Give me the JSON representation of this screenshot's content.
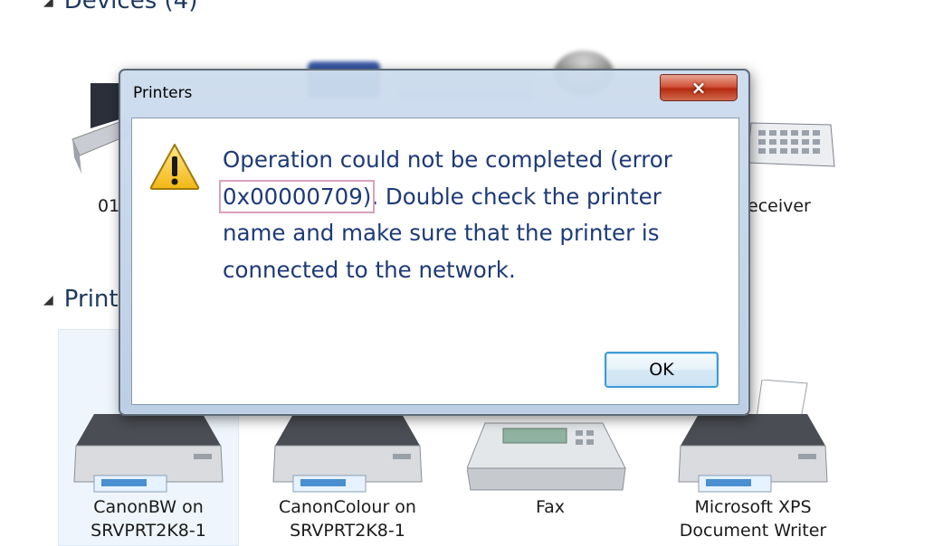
{
  "background": {
    "devices_header": "Devices (4)",
    "printers_header": "Print",
    "device_labels": {
      "device_1_partial": "01",
      "device_4_partial": "eceiver"
    },
    "printers": [
      {
        "line1": "CanonBW on",
        "line2": "SRVPRT2K8-1"
      },
      {
        "line1": "CanonColour on",
        "line2": "SRVPRT2K8-1"
      },
      {
        "line1": "Fax",
        "line2": ""
      },
      {
        "line1": "Microsoft XPS",
        "line2": "Document Writer"
      }
    ]
  },
  "dialog": {
    "title": "Printers",
    "close_icon": "×",
    "message_before": "Operation could not be completed (error ",
    "error_code": "0x00000709)",
    "message_after": ". Double check the printer name and make sure that the printer is connected to the network.",
    "ok_label": "OK",
    "icon": "warning-icon"
  },
  "colors": {
    "message_text": "#1d3a78",
    "highlight_box": "#d9a1ba",
    "close_button": "#c8432a",
    "ok_button_border": "#3c9bd6"
  }
}
